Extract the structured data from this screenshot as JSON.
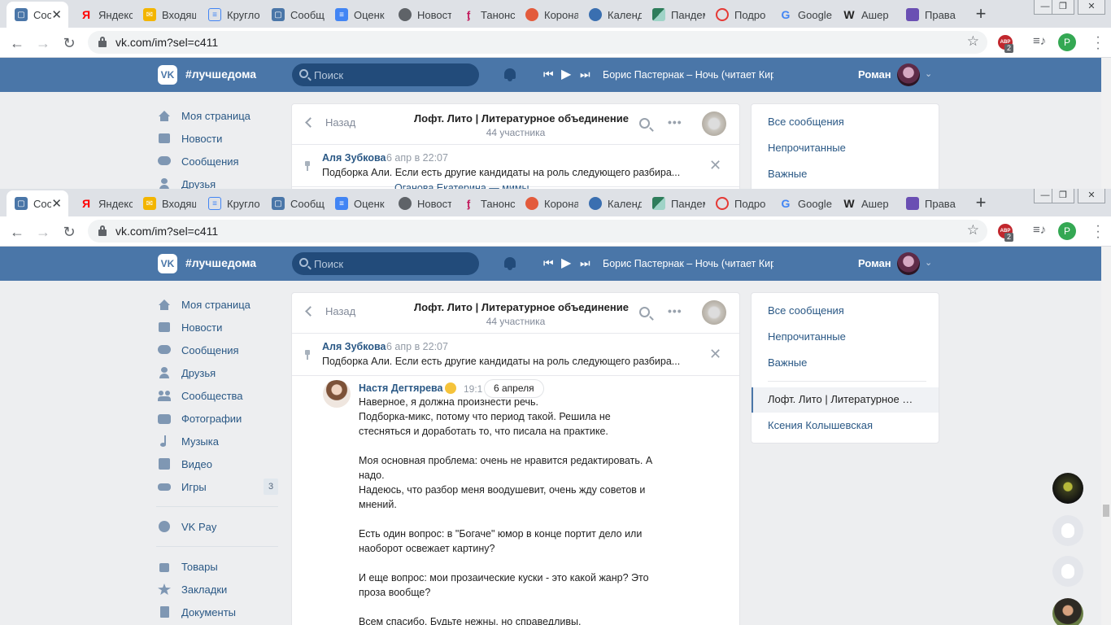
{
  "browser": {
    "tabs": [
      {
        "title": "Сообщ",
        "active": true
      },
      {
        "title": "Яндекс"
      },
      {
        "title": "Входящ"
      },
      {
        "title": "Кругло"
      },
      {
        "title": "Сообщ"
      },
      {
        "title": "Оценк"
      },
      {
        "title": "Новост"
      },
      {
        "title": "Танонс"
      },
      {
        "title": "Корона"
      },
      {
        "title": "Календ"
      },
      {
        "title": "Пандем"
      },
      {
        "title": "Подро"
      },
      {
        "title": "Google"
      },
      {
        "title": "Ашер"
      },
      {
        "title": "Права"
      }
    ],
    "url": "vk.com/im?sel=c411",
    "abp_badge": "2",
    "profile_letter": "Р"
  },
  "vk": {
    "logo": "VK",
    "hashtag": "#лучшедома",
    "search_placeholder": "Поиск",
    "now_playing": "Борис Пастернак – Ночь (читает Кирилл Лавров)",
    "user_name": "Роман",
    "accent_color": "#4a76a8"
  },
  "left_nav": {
    "items": [
      {
        "label": "Моя страница",
        "icon": "home-icon"
      },
      {
        "label": "Новости",
        "icon": "news-icon"
      },
      {
        "label": "Сообщения",
        "icon": "messages-icon"
      },
      {
        "label": "Друзья",
        "icon": "friends-icon"
      },
      {
        "label": "Сообщества",
        "icon": "groups-icon"
      },
      {
        "label": "Фотографии",
        "icon": "camera-icon"
      },
      {
        "label": "Музыка",
        "icon": "music-icon"
      },
      {
        "label": "Видео",
        "icon": "video-icon"
      },
      {
        "label": "Игры",
        "icon": "games-icon",
        "badge": "3"
      }
    ],
    "vkpay": "VK Pay",
    "extra": [
      {
        "label": "Товары",
        "icon": "bag-icon"
      },
      {
        "label": "Закладки",
        "icon": "star-icon"
      },
      {
        "label": "Документы",
        "icon": "document-icon"
      }
    ]
  },
  "chat": {
    "back": "Назад",
    "title": "Лофт. Лито | Литературное объединение",
    "members": "44 участника",
    "pinned": {
      "author": "Аля Зубкова",
      "time": "6 апр в 22:07",
      "text": "Подборка Али. Если есть другие кандидаты на роль следующего разбира..."
    },
    "behind_text": "Оганова Екатерина — мимы",
    "date_pill": "6 апреля",
    "message": {
      "author": "Настя Дегтярева",
      "time": "19:1",
      "text": "Наверное, я должна произнести речь.\nПодборка-микс, потому что период такой. Решила не\nстесняться и доработать то, что писала на практике.\n\nМоя основная проблема: очень не нравится редактировать. А\nнадо.\nНадеюсь, что разбор меня воодушевит, очень жду советов и\nмнений.\n\nЕсть один вопрос: в \"Богаче\" юмор в конце портит дело или\nнаоборот освежает картину?\n\nИ еще вопрос: мои прозаические куски - это какой жанр? Это\nпроза вообще?\n\nВсем спасибо. Будьте нежны, но справедливы."
    }
  },
  "right_panel": {
    "all": "Все сообщения",
    "unread": "Непрочитанные",
    "important": "Важные",
    "selected": "Лофт. Лито | Литературное объединение",
    "other": "Ксения Колышевская"
  }
}
